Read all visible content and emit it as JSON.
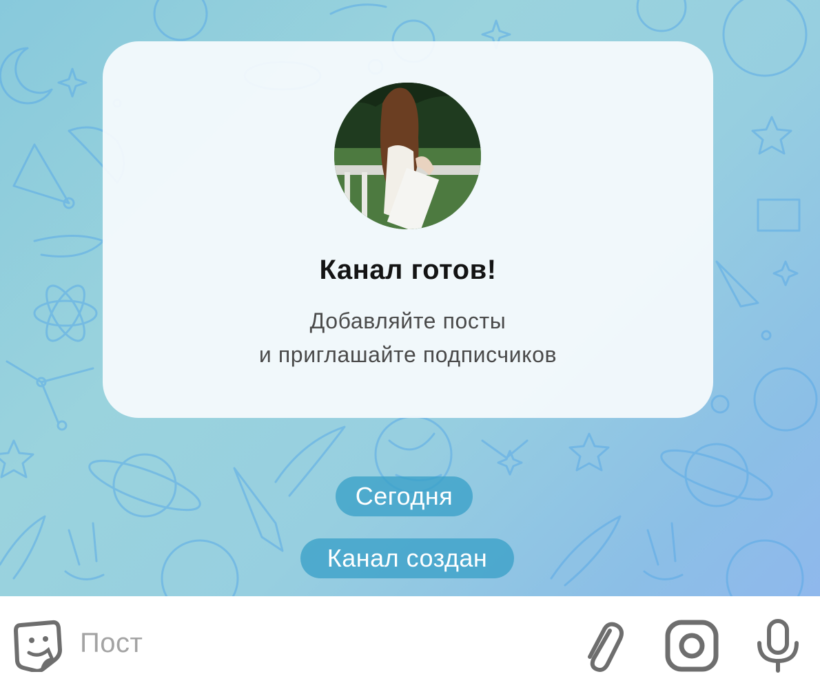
{
  "card": {
    "title": "Канал готов!",
    "subtitle_line1": "Добавляйте посты",
    "subtitle_line2": "и приглашайте подписчиков"
  },
  "date_separator": "Сегодня",
  "service_message": "Канал создан",
  "composer": {
    "placeholder": "Пост",
    "icons": [
      "sticker-icon",
      "paperclip-icon",
      "camera-icon",
      "microphone-icon"
    ]
  },
  "colors": {
    "background_start": "#88c9dc",
    "background_end": "#8fb8ec",
    "doodle": "#5aa9e6",
    "pill": "#3aa0c8",
    "icon": "#6e6e6e"
  }
}
